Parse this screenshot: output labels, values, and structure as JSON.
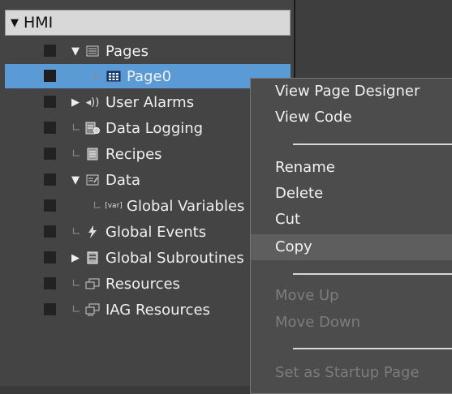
{
  "tree": {
    "root_label": "HMI",
    "items": [
      {
        "label": "Pages",
        "icon": "pages-icon",
        "expander": "▼"
      },
      {
        "label": "Page0",
        "icon": "page-grid-icon",
        "expander": ""
      },
      {
        "label": "User Alarms",
        "icon": "alarm-speaker-icon",
        "expander": "▶"
      },
      {
        "label": "Data Logging",
        "icon": "data-logging-icon",
        "expander": ""
      },
      {
        "label": "Recipes",
        "icon": "recipes-icon",
        "expander": ""
      },
      {
        "label": "Data",
        "icon": "data-icon",
        "expander": "▼"
      },
      {
        "label": "Global Variables",
        "icon": "var-icon",
        "expander": ""
      },
      {
        "label": "Global Events",
        "icon": "lightning-icon",
        "expander": ""
      },
      {
        "label": "Global Subroutines",
        "icon": "subroutine-icon",
        "expander": "▶"
      },
      {
        "label": "Resources",
        "icon": "resources-icon",
        "expander": ""
      },
      {
        "label": "IAG Resources",
        "icon": "iag-resources-icon",
        "expander": ""
      }
    ],
    "var_tag": "[var]"
  },
  "context_menu": {
    "items": [
      {
        "label": "View Page Designer",
        "enabled": true
      },
      {
        "label": "View Code",
        "enabled": true
      },
      {
        "label": "Rename",
        "enabled": true
      },
      {
        "label": "Delete",
        "enabled": true
      },
      {
        "label": "Cut",
        "enabled": true
      },
      {
        "label": "Copy",
        "enabled": true
      },
      {
        "label": "Move Up",
        "enabled": false
      },
      {
        "label": "Move Down",
        "enabled": false
      },
      {
        "label": "Set as Startup Page",
        "enabled": false
      }
    ]
  },
  "colors": {
    "selection": "#5b9bd5",
    "tree_bg": "#444444",
    "menu_bg": "#4c4c4c",
    "disabled_text": "#7c7c7c"
  }
}
